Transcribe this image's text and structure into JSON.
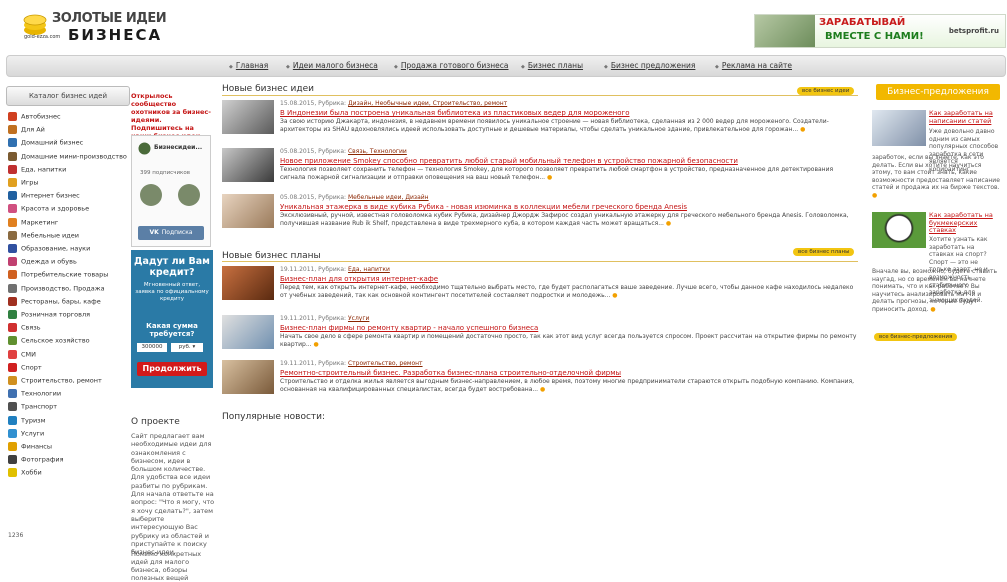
{
  "header": {
    "logo_line1": "ЗОЛОТЫЕ ИДЕИ",
    "logo_line2": "БИЗНЕСА",
    "logo_small": "gold-ezza.com",
    "banner_line1": "ЗАРАБАТЫВАЙ",
    "banner_line2": "ВМЕСТЕ С НАМИ!",
    "banner_url": "betsprofit.ru"
  },
  "nav": [
    "Главная",
    "Идеи малого бизнеса",
    "Продажа готового бизнеса",
    "Бизнес планы",
    "Бизнес предложения",
    "Реклама на сайте"
  ],
  "left": {
    "header": "Каталог бизнес идей",
    "categories": [
      {
        "label": "Автобизнес",
        "color": "#d04020"
      },
      {
        "label": "Для Ай",
        "color": "#c07020"
      },
      {
        "label": "Домашний бизнес",
        "color": "#3070b0"
      },
      {
        "label": "Домашние мини-производство",
        "color": "#7a5a30"
      },
      {
        "label": "Еда, напитки",
        "color": "#c03030"
      },
      {
        "label": "Игры",
        "color": "#e0a020"
      },
      {
        "label": "Интернет бизнес",
        "color": "#2060a0"
      },
      {
        "label": "Красота и здоровье",
        "color": "#d05080"
      },
      {
        "label": "Маркетинг",
        "color": "#e08020"
      },
      {
        "label": "Мебельные идеи",
        "color": "#8a6a40"
      },
      {
        "label": "Образование, науки",
        "color": "#3050a0"
      },
      {
        "label": "Одежда и обувь",
        "color": "#c04070"
      },
      {
        "label": "Потребительские товары",
        "color": "#d06020"
      },
      {
        "label": "Производство, Продажа",
        "color": "#707070"
      },
      {
        "label": "Рестораны, бары, кафе",
        "color": "#a03020"
      },
      {
        "label": "Розничная торговля",
        "color": "#308040"
      },
      {
        "label": "Связь",
        "color": "#d03030"
      },
      {
        "label": "Сельское хозяйство",
        "color": "#609030"
      },
      {
        "label": "СМИ",
        "color": "#e04040"
      },
      {
        "label": "Спорт",
        "color": "#d02020"
      },
      {
        "label": "Строительство, ремонт",
        "color": "#d09020"
      },
      {
        "label": "Технологии",
        "color": "#4070b0"
      },
      {
        "label": "Транспорт",
        "color": "#505050"
      },
      {
        "label": "Туризм",
        "color": "#2080c0"
      },
      {
        "label": "Услуги",
        "color": "#3090d0"
      },
      {
        "label": "Финансы",
        "color": "#e0a000"
      },
      {
        "label": "Фотография",
        "color": "#404040"
      },
      {
        "label": "Хобби",
        "color": "#e0c000"
      }
    ],
    "counter": "1236"
  },
  "second": {
    "promo": "Открылось сообщество охотников за бизнес-идеями. Подпишитесь на наши бизнес идеи вконтакте",
    "vk_name": "Бизнесидеи...",
    "vk_count": "399 подписчиков",
    "vk_button": "Подписка",
    "credit_title": "Дадут ли Вам кредит?",
    "credit_sub": "Мгновенный ответ, заявка по официальному кредиту",
    "credit_question": "Какая сумма требуется?",
    "credit_sum": "300000",
    "credit_currency": "руб.",
    "credit_button": "Продолжить",
    "about_title": "О проекте",
    "about_p1": "Сайт предлагает вам необходимые идеи для ознакомления с бизнесом, идеи в большом количестве. Для удобства все идеи разбиты по рубрикам. Для начала ответьте на вопрос: \"Что я могу, что я хочу сделать?\", затем выберите интересующую Вас рубрику из областей и приступайте к поиску бизнес-идеи.",
    "about_p2": "Помимо конкретных идей для малого бизнеса, обзоры полезных вещей"
  },
  "main": {
    "ideas_title": "Новые бизнес идеи",
    "ideas_all": "все бизнес идеи",
    "ideas": [
      {
        "date": "15.08.2015, Рубрика: ",
        "tags": "Дизайн, Необычные идеи, Строительство, ремонт",
        "title": "В Индонезии была построена уникальная библиотека из пластиковых ведер для мороженого",
        "summary": "За свою историю Джакарта, индонезия, в недавнем времени появилось уникальное строение — новая библиотека, сделанная из 2 000 ведер для мороженого. Создатели-архитекторы из SHAU вдохновлялись идеей использовать доступные и дешевые материалы, чтобы сделать уникальное здание, привлекательное для горожан..."
      },
      {
        "date": "05.08.2015, Рубрика: ",
        "tags": "Связь, Технологии",
        "title": "Новое приложение Smokey способно превратить любой старый мобильный телефон в устройство пожарной безопасности",
        "summary": "Технология позволяет сохранить телефон — технология Smokey, для которого позволяет превратить любой смартфон в устройство, предназначенное для детектирования сигнала пожарной сигнализации и отправки оповещения на ваш новый телефон..."
      },
      {
        "date": "05.08.2015, Рубрика: ",
        "tags": "Мебельные идеи, Дизайн",
        "title": "Уникальная этажерка в виде кубика Рубика - новая изюминка в коллекции мебели греческого бренда Anesis",
        "summary": "Эксклюзивный, ручной, известная головоломка кубик Рубика, дизайнер Джордж Зафирос создал уникальную этажерку для греческого мебельного бренда Anesis. Головоломка, получившая название Rub ik Shelf, представлена в виде трехмерного куба, в котором каждая часть может вращаться..."
      }
    ],
    "plans_title": "Новые бизнес планы",
    "plans_all": "все бизнес планы",
    "plans": [
      {
        "date": "19.11.2011, Рубрика: ",
        "tags": "Еда, напитки",
        "title": "Бизнес-план для открытия интернет-кафе",
        "summary": "Перед тем, как открыть интернет-кафе, необходимо тщательно выбрать место, где будет располагаться ваше заведение. Лучше всего, чтобы данное кафе находилось недалеко от учебных заведений, так как основной контингент посетителей составляет подростки и молодежь..."
      },
      {
        "date": "19.11.2011, Рубрика: ",
        "tags": "Услуги",
        "title": "Бизнес-план фирмы по ремонту квартир - начало успешного бизнеса",
        "summary": "Начать свое дело в сфере ремонта квартир и помещений достаточно просто, так как этот вид услуг всегда пользуется спросом. Проект рассчитан на открытие фирмы по ремонту квартир..."
      },
      {
        "date": "19.11.2011, Рубрика: ",
        "tags": "Строительство, ремонт",
        "title": "Ремонтно-строительный бизнес. Разработка бизнес-плана строительно-отделочной фирмы",
        "summary": "Строительство и отделка жилья является выгодным бизнес-направлением, в любое время, поэтому многие предприниматели стараются открыть подобную компанию. Компания, основанная на квалифицированных специалистах, всегда будет востребована..."
      }
    ],
    "popular_title": "Популярные новости:"
  },
  "right": {
    "header": "Бизнес-предложения",
    "items": [
      {
        "title": "Как заработать на написании статей",
        "text": "Уже довольно давно одним из самых популярных способов заработка в сети является копирайтинг."
      },
      {
        "title": "Как заработать на букмекерских ставках",
        "text": "Хотите узнать как заработать на ставках на спорт? Спорт — это не только азарт, но и возможность стабильного заработка для знающих людей."
      }
    ],
    "item1_extra": "заработок, если вы знаете, как это делать. Если вы хотите научиться этому, то вам стоит знать, какие возможности предоставляет написание статей и продажа их на бирже текстов.",
    "item2_extra": "Вначале вы, возможно, будете ставить наугад, но со временем вы начнете понимать, что и как работает. Вы научитесь анализировать матчи и делать прогнозы, которые будут приносить доход.",
    "all_link": "все бизнес-предложения"
  }
}
